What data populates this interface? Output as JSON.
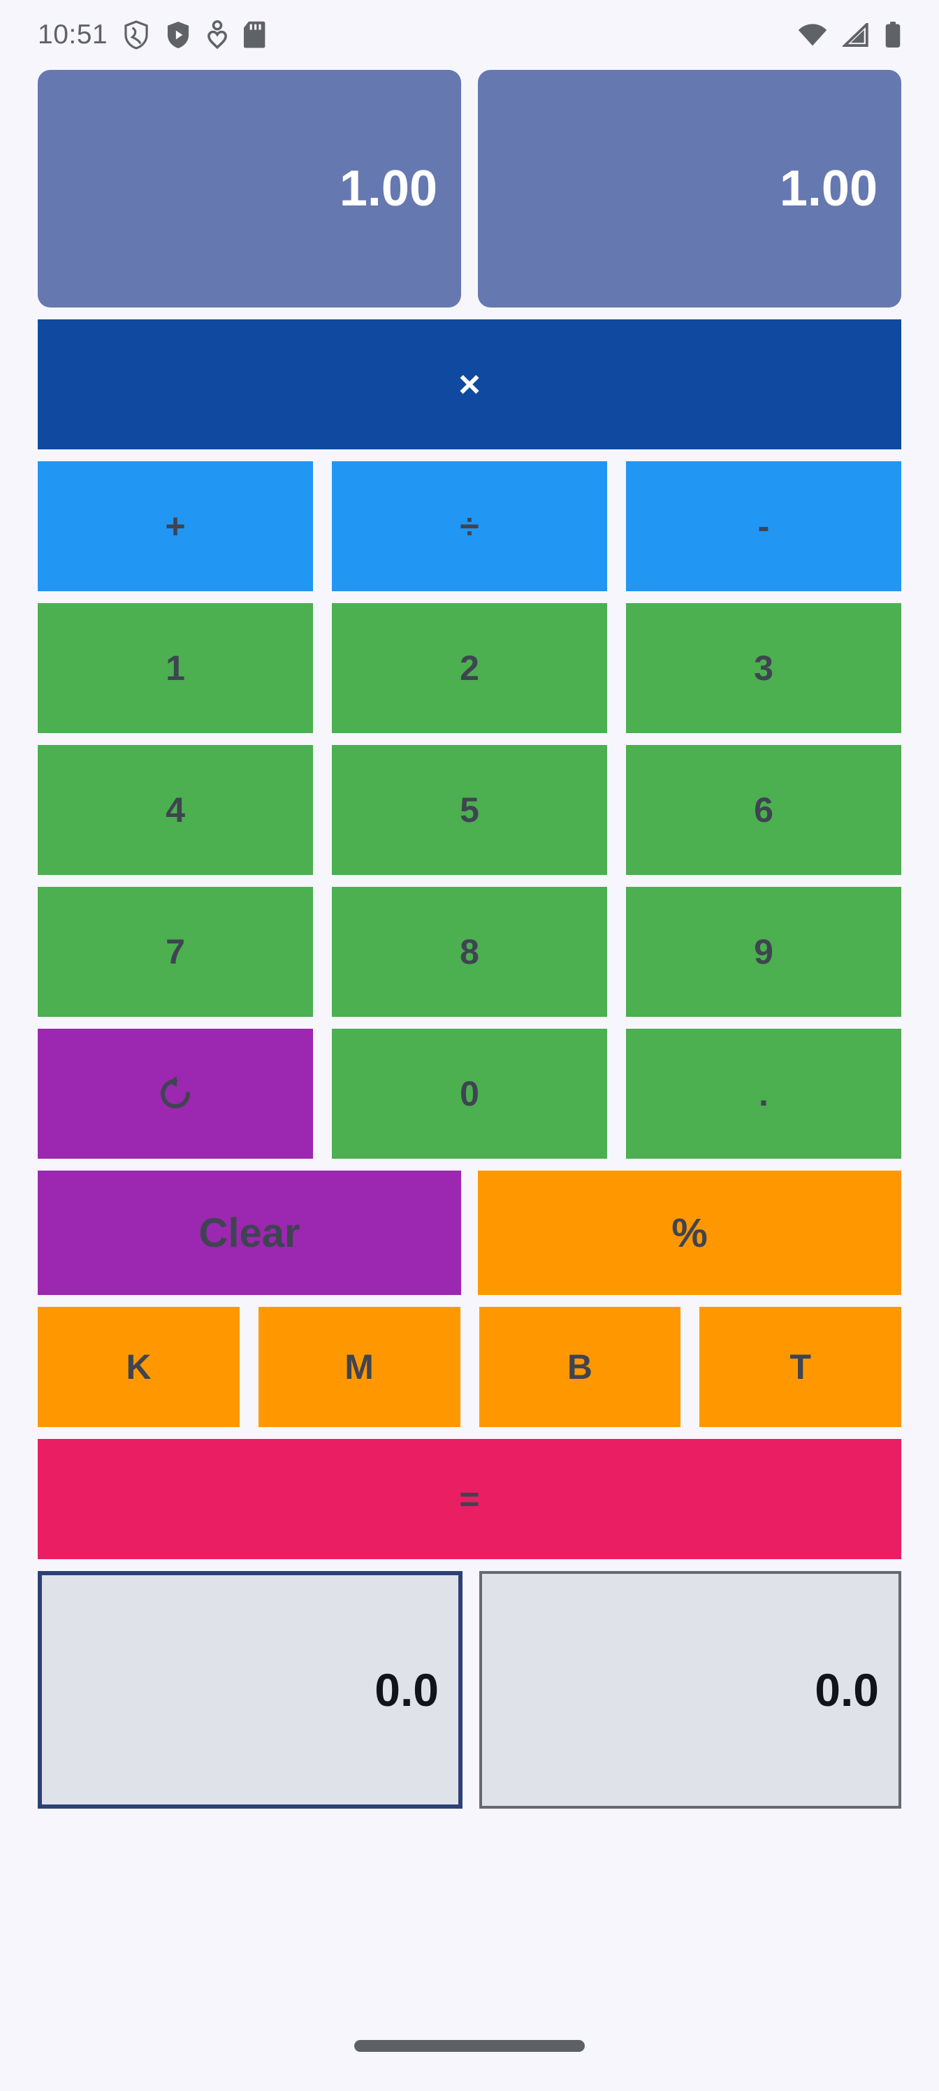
{
  "status_bar": {
    "time": "10:51",
    "left_icons": [
      "shield-outline-icon",
      "shield-play-icon",
      "location-heart-icon",
      "sd-card-icon"
    ],
    "right_icons": [
      "wifi-icon",
      "cellular-signal-icon",
      "battery-full-icon"
    ]
  },
  "display": {
    "left_value": "1.00",
    "right_value": "1.00"
  },
  "current_operator": {
    "symbol": "×",
    "name": "multiply"
  },
  "operators": [
    {
      "label": "+",
      "name": "plus"
    },
    {
      "label": "÷",
      "name": "divide"
    },
    {
      "label": "-",
      "name": "minus"
    }
  ],
  "keypad": [
    [
      {
        "label": "1"
      },
      {
        "label": "2"
      },
      {
        "label": "3"
      }
    ],
    [
      {
        "label": "4"
      },
      {
        "label": "5"
      },
      {
        "label": "6"
      }
    ],
    [
      {
        "label": "7"
      },
      {
        "label": "8"
      },
      {
        "label": "9"
      }
    ]
  ],
  "bottom_keypad": {
    "reset_icon": "refresh-icon",
    "zero": "0",
    "decimal": "."
  },
  "actions": {
    "clear": "Clear",
    "percent": "%"
  },
  "multipliers": [
    {
      "label": "K",
      "name": "thousand"
    },
    {
      "label": "M",
      "name": "million"
    },
    {
      "label": "B",
      "name": "billion"
    },
    {
      "label": "T",
      "name": "trillion"
    }
  ],
  "equals": {
    "label": "="
  },
  "results": {
    "left_value": "0.0",
    "right_value": "0.0"
  },
  "colors": {
    "background": "#f6f6fc",
    "display_panel": "#6678b0",
    "operator_active": "#0f4aa0",
    "operator": "#2196f3",
    "number": "#4caf50",
    "purple": "#9c27b0",
    "orange": "#ff9800",
    "equals": "#e91e63",
    "key_text": "#3f4451",
    "input_bg": "#e0e2ea",
    "input_focus_border": "#2c4275",
    "input_border": "#656a70"
  }
}
